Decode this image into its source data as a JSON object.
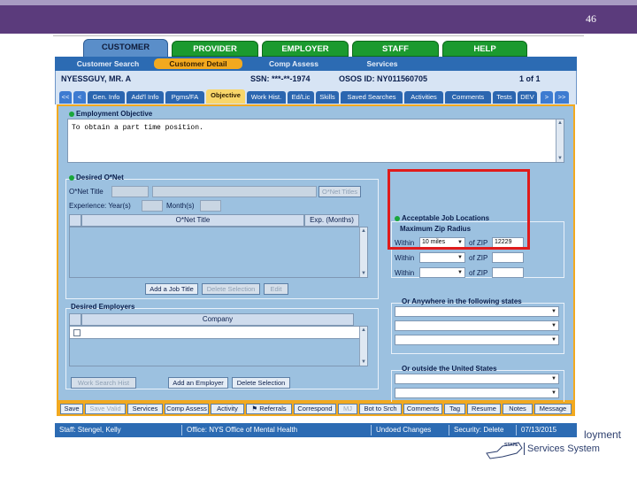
{
  "slide": {
    "number": "46"
  },
  "main_tabs": [
    "CUSTOMER",
    "PROVIDER",
    "EMPLOYER",
    "STAFF",
    "HELP"
  ],
  "sub_nav": [
    "Customer Search",
    "Customer Detail",
    "Comp Assess",
    "Services"
  ],
  "customer": {
    "name": "NYESSGUY, MR. A",
    "ssn": "SSN: ***-**-1974",
    "osos_id": "OSOS ID: NY011560705",
    "paging": "1 of 1"
  },
  "profile_tabs": [
    "<<",
    "<",
    "Gen. Info",
    "Add'l Info",
    "Pgms/FA",
    "Objective",
    "Work Hist.",
    "Ed/Lic",
    "Skills",
    "Saved Searches",
    "Activities",
    "Comments",
    "Tests",
    "DEV",
    ">",
    ">>"
  ],
  "employment_objective": {
    "label": "Employment Objective",
    "text": "To obtain a part time position."
  },
  "desired_onet": {
    "label": "Desired O*Net",
    "onet_title_label": "O*Net Title",
    "onet_titles_button": "O*Net Titles",
    "experience_label": "Experience: Year(s)",
    "months_label": "Month(s)",
    "col_title": "O*Net Title",
    "col_exp": "Exp. (Months)",
    "add_button": "Add a Job Title",
    "delete_button": "Delete Selection",
    "edit_button": "Edit"
  },
  "desired_employers": {
    "label": "Desired Employers",
    "col_company": "Company",
    "work_search_button": "Work Search Hist",
    "add_button": "Add an Employer",
    "delete_button": "Delete Selection"
  },
  "job_locations": {
    "label": "Acceptable Job Locations",
    "radius_label": "Maximum Zip Radius",
    "within_label": "Within",
    "of_zip_label": "of ZIP",
    "rows": [
      {
        "miles": "10 miles",
        "zip": "12229"
      },
      {
        "miles": "",
        "zip": ""
      },
      {
        "miles": "",
        "zip": ""
      }
    ],
    "anywhere_label": "Or Anywhere in the following states",
    "outside_label": "Or outside the United States"
  },
  "bottom_buttons": [
    "Save",
    "Save Valid",
    "Services",
    "Comp Assess",
    "Activity",
    "Referrals",
    "Correspond",
    "MJ",
    "Bot to Srch",
    "Comments",
    "Tag",
    "Resume",
    "Notes",
    "Message"
  ],
  "status": {
    "staff": "Staff: Stengel, Kelly",
    "office": "Office: NYS Office of Mental Health",
    "changes": "Undoed Changes",
    "security": "Security: Delete",
    "date": "07/13/2015"
  },
  "brand": {
    "line1": "loyment",
    "state": "STATE",
    "line2": "Services System"
  },
  "colors": {
    "slide_bar": "#5b3b7c",
    "tab_green": "#1b9a2f",
    "nav_blue": "#2c6bb3",
    "accent_orange": "#f2a91f",
    "panel_blue": "#9cc1e0",
    "highlight_red": "#e01b1b"
  }
}
